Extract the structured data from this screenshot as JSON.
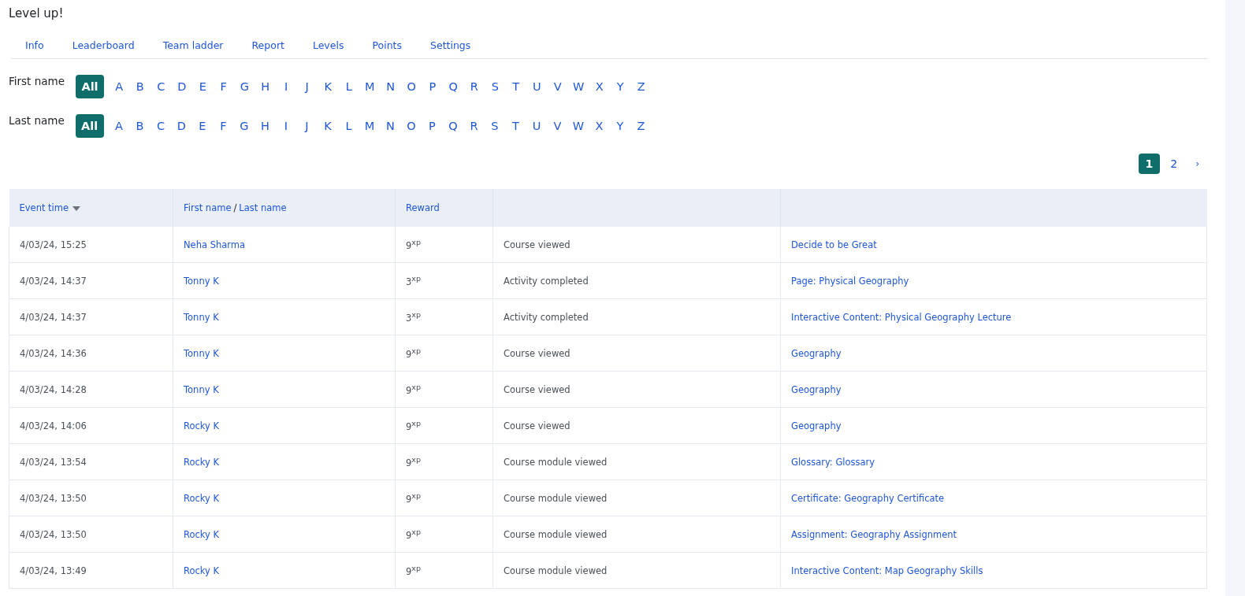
{
  "title": "Level up!",
  "tabs": [
    {
      "label": "Info",
      "selected": false
    },
    {
      "label": "Leaderboard",
      "selected": false
    },
    {
      "label": "Team ladder",
      "selected": false
    },
    {
      "label": "Report",
      "selected": false
    },
    {
      "label": "Levels",
      "selected": false
    },
    {
      "label": "Points",
      "selected": false
    },
    {
      "label": "Settings",
      "selected": false
    }
  ],
  "filters": [
    {
      "label": "First name",
      "letters": [
        {
          "label": "All",
          "selected": true
        },
        {
          "label": "A",
          "selected": false
        },
        {
          "label": "B",
          "selected": false
        },
        {
          "label": "C",
          "selected": false
        },
        {
          "label": "D",
          "selected": false
        },
        {
          "label": "E",
          "selected": false
        },
        {
          "label": "F",
          "selected": false
        },
        {
          "label": "G",
          "selected": false
        },
        {
          "label": "H",
          "selected": false
        },
        {
          "label": "I",
          "selected": false
        },
        {
          "label": "J",
          "selected": false
        },
        {
          "label": "K",
          "selected": false
        },
        {
          "label": "L",
          "selected": false
        },
        {
          "label": "M",
          "selected": false
        },
        {
          "label": "N",
          "selected": false
        },
        {
          "label": "O",
          "selected": false
        },
        {
          "label": "P",
          "selected": false
        },
        {
          "label": "Q",
          "selected": false
        },
        {
          "label": "R",
          "selected": false
        },
        {
          "label": "S",
          "selected": false
        },
        {
          "label": "T",
          "selected": false
        },
        {
          "label": "U",
          "selected": false
        },
        {
          "label": "V",
          "selected": false
        },
        {
          "label": "W",
          "selected": false
        },
        {
          "label": "X",
          "selected": false
        },
        {
          "label": "Y",
          "selected": false
        },
        {
          "label": "Z",
          "selected": false
        }
      ]
    },
    {
      "label": "Last name",
      "letters": [
        {
          "label": "All",
          "selected": true
        },
        {
          "label": "A",
          "selected": false
        },
        {
          "label": "B",
          "selected": false
        },
        {
          "label": "C",
          "selected": false
        },
        {
          "label": "D",
          "selected": false
        },
        {
          "label": "E",
          "selected": false
        },
        {
          "label": "F",
          "selected": false
        },
        {
          "label": "G",
          "selected": false
        },
        {
          "label": "H",
          "selected": false
        },
        {
          "label": "I",
          "selected": false
        },
        {
          "label": "J",
          "selected": false
        },
        {
          "label": "K",
          "selected": false
        },
        {
          "label": "L",
          "selected": false
        },
        {
          "label": "M",
          "selected": false
        },
        {
          "label": "N",
          "selected": false
        },
        {
          "label": "O",
          "selected": false
        },
        {
          "label": "P",
          "selected": false
        },
        {
          "label": "Q",
          "selected": false
        },
        {
          "label": "R",
          "selected": false
        },
        {
          "label": "S",
          "selected": false
        },
        {
          "label": "T",
          "selected": false
        },
        {
          "label": "U",
          "selected": false
        },
        {
          "label": "V",
          "selected": false
        },
        {
          "label": "W",
          "selected": false
        },
        {
          "label": "X",
          "selected": false
        },
        {
          "label": "Y",
          "selected": false
        },
        {
          "label": "Z",
          "selected": false
        }
      ]
    }
  ],
  "pagination": {
    "pages": [
      {
        "label": "1",
        "selected": true
      },
      {
        "label": "2",
        "selected": false
      }
    ],
    "next": "›"
  },
  "table": {
    "columns": {
      "event_time": "Event time",
      "first_name": "First name",
      "separator": "/",
      "last_name": "Last name",
      "reward": "Reward"
    },
    "rows": [
      {
        "time": "4/03/24, 15:25",
        "name": "Neha Sharma",
        "reward": "9$^{xp}$",
        "event": "Course viewed",
        "context": "Decide to be Great"
      },
      {
        "time": "4/03/24, 14:37",
        "name": "Tonny K",
        "reward": "3$^{xp}$",
        "event": "Activity completed",
        "context": "Page: Physical Geography"
      },
      {
        "time": "4/03/24, 14:37",
        "name": "Tonny K",
        "reward": "3$^{xp}$",
        "event": "Activity completed",
        "context": "Interactive Content: Physical Geography Lecture"
      },
      {
        "time": "4/03/24, 14:36",
        "name": "Tonny K",
        "reward": "9$^{xp}$",
        "event": "Course viewed",
        "context": "Geography"
      },
      {
        "time": "4/03/24, 14:28",
        "name": "Tonny K",
        "reward": "9$^{xp}$",
        "event": "Course viewed",
        "context": "Geography"
      },
      {
        "time": "4/03/24, 14:06",
        "name": "Rocky K",
        "reward": "9$^{xp}$",
        "event": "Course viewed",
        "context": "Geography"
      },
      {
        "time": "4/03/24, 13:54",
        "name": "Rocky K",
        "reward": "9$^{xp}$",
        "event": "Course module viewed",
        "context": "Glossary: Glossary"
      },
      {
        "time": "4/03/24, 13:50",
        "name": "Rocky K",
        "reward": "9$^{xp}$",
        "event": "Course module viewed",
        "context": "Certificate: Geography Certificate"
      },
      {
        "time": "4/03/24, 13:50",
        "name": "Rocky K",
        "reward": "9$^{xp}$",
        "event": "Course module viewed",
        "context": "Assignment: Geography Assignment"
      },
      {
        "time": "4/03/24, 13:49",
        "name": "Rocky K",
        "reward": "9$^{xp}$",
        "event": "Course module viewed",
        "context": "Interactive Content: Map Geography Skills"
      }
    ]
  }
}
